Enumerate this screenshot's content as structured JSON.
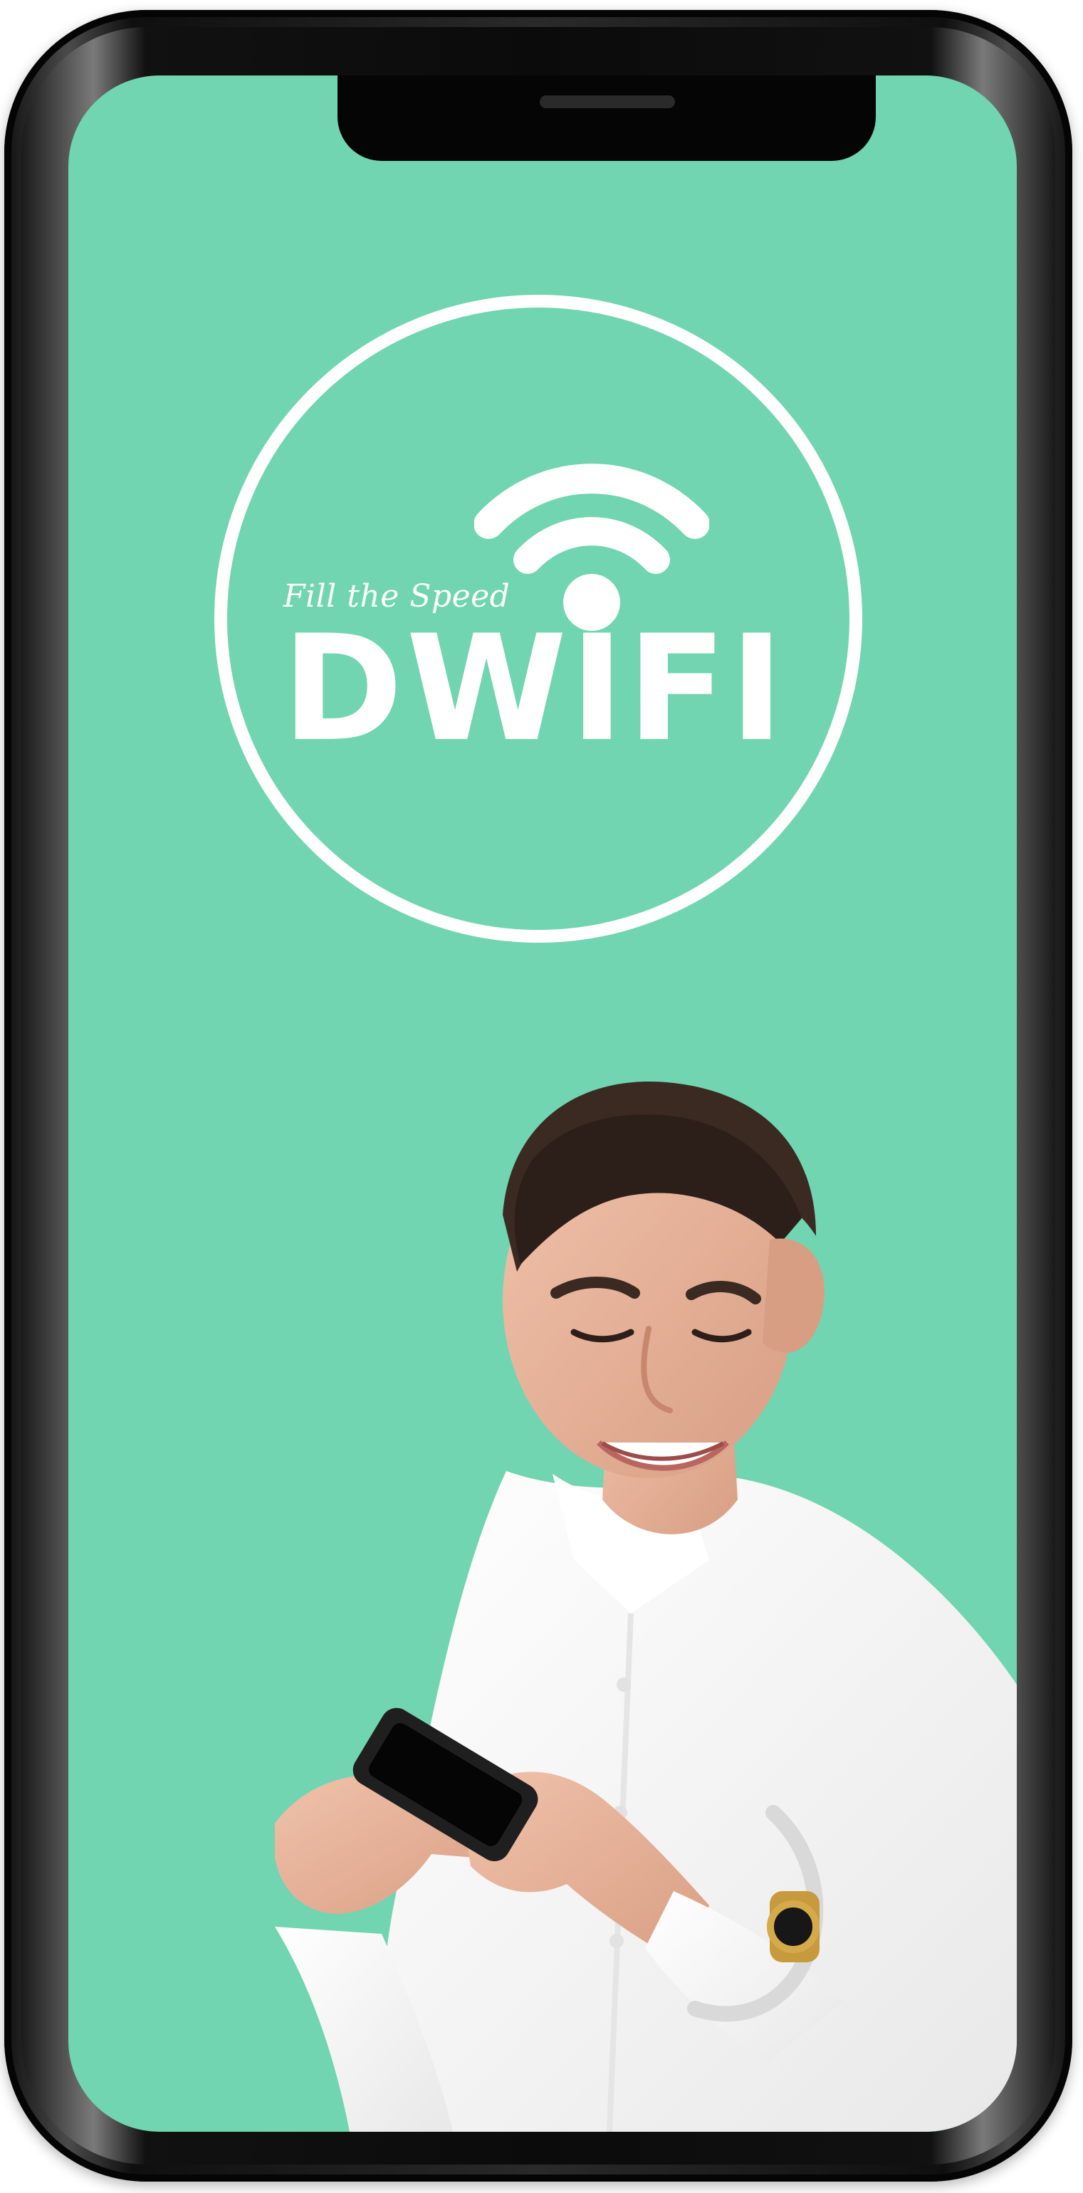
{
  "colors": {
    "screen_background": "#70d5b0",
    "logo_white": "#ffffff"
  },
  "logo": {
    "tagline": "Fill the Speed",
    "wordmark": "DWIFI",
    "icon": "wifi-icon"
  },
  "illustration": {
    "subject": "man-holding-phone-photo"
  }
}
